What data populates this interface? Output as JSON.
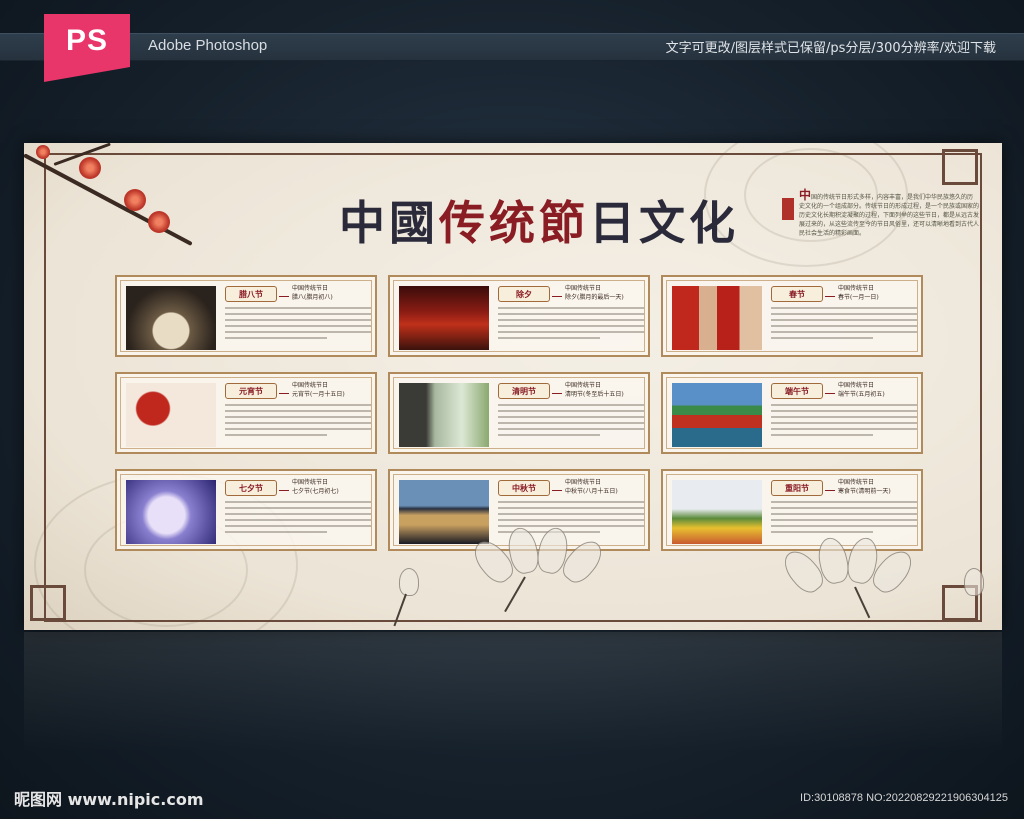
{
  "header": {
    "logo_text": "PS",
    "app_name": "Adobe Photoshop",
    "note": "文字可更改/图层样式已保留/ps分层/300分辨率/欢迎下载"
  },
  "board": {
    "title_part1": "中國",
    "title_part2": "传统",
    "title_part3": "節",
    "title_part4": "日文化",
    "intro_initial": "中",
    "intro_text": "国的传统节日形式多样，内容丰富，是我们中华民族悠久的历史文化的一个组成部分。传统节日的形成过程，是一个民族或国家的历史文化长期积淀凝聚的过程，下面列举的这些节日，都是从远古发展过来的，从这些流传至今的节日风俗里，还可以清晰地看到古代人民社会生活的精彩画面。"
  },
  "festivals": [
    {
      "tag": "腊八节",
      "sub1": "中国传统节日",
      "sub2": "腊八(腊月初八)"
    },
    {
      "tag": "除夕",
      "sub1": "中国传统节日",
      "sub2": "除夕(腊月的最后一天)"
    },
    {
      "tag": "春节",
      "sub1": "中国传统节日",
      "sub2": "春节(一月一日)"
    },
    {
      "tag": "元宵节",
      "sub1": "中国传统节日",
      "sub2": "元宵节(一月十五日)"
    },
    {
      "tag": "清明节",
      "sub1": "中国传统节日",
      "sub2": "清明节(冬至后十五日)"
    },
    {
      "tag": "端午节",
      "sub1": "中国传统节日",
      "sub2": "端午节(五月初五)"
    },
    {
      "tag": "七夕节",
      "sub1": "中国传统节日",
      "sub2": "七夕节(七月初七)"
    },
    {
      "tag": "中秋节",
      "sub1": "中国传统节日",
      "sub2": "中秋节(八月十五日)"
    },
    {
      "tag": "重阳节",
      "sub1": "中国传统节日",
      "sub2": "寒食节(清明前一天)"
    }
  ],
  "footer": {
    "watermark": "昵图网 www.nipic.com",
    "id_text": "ID:30108878 NO:20220829221906304125"
  },
  "colors": {
    "accent_red": "#8a1c24",
    "ps_pink": "#e8366a",
    "frame_brown": "#6a4a3a"
  }
}
